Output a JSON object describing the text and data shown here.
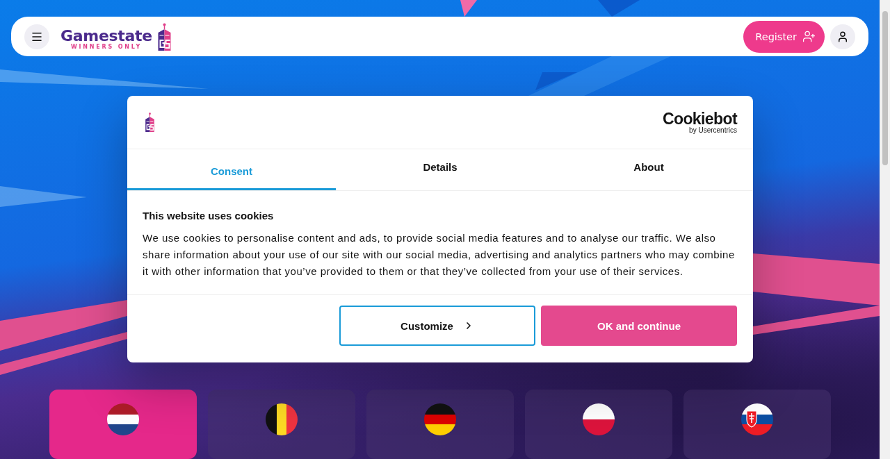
{
  "header": {
    "logo": {
      "name": "Gamestate",
      "tagline": "WINNERS ONLY"
    },
    "register_button": "Register"
  },
  "cookie_dialog": {
    "brand": "Cookiebot",
    "brand_byline": "by Usercentrics",
    "tabs": [
      {
        "label": "Consent",
        "selected": true
      },
      {
        "label": "Details",
        "selected": false
      },
      {
        "label": "About",
        "selected": false
      }
    ],
    "title": "This website uses cookies",
    "text": "We use cookies to personalise content and ads, to provide social media features and to analyse our traffic. We also share information about your use of our site with our social media, advertising and analytics partners who may combine it with other information that you’ve provided to them or that they’ve collected from your use of their services.",
    "buttons": [
      {
        "label": "Customize",
        "kind": "outline"
      },
      {
        "label": "OK and continue",
        "kind": "primary"
      }
    ]
  },
  "countries": [
    {
      "kind": "netherlands",
      "selected": true
    },
    {
      "kind": "belgium",
      "selected": false
    },
    {
      "kind": "germany",
      "selected": false
    },
    {
      "kind": "poland",
      "selected": false
    },
    {
      "kind": "slovakia",
      "selected": false
    }
  ]
}
